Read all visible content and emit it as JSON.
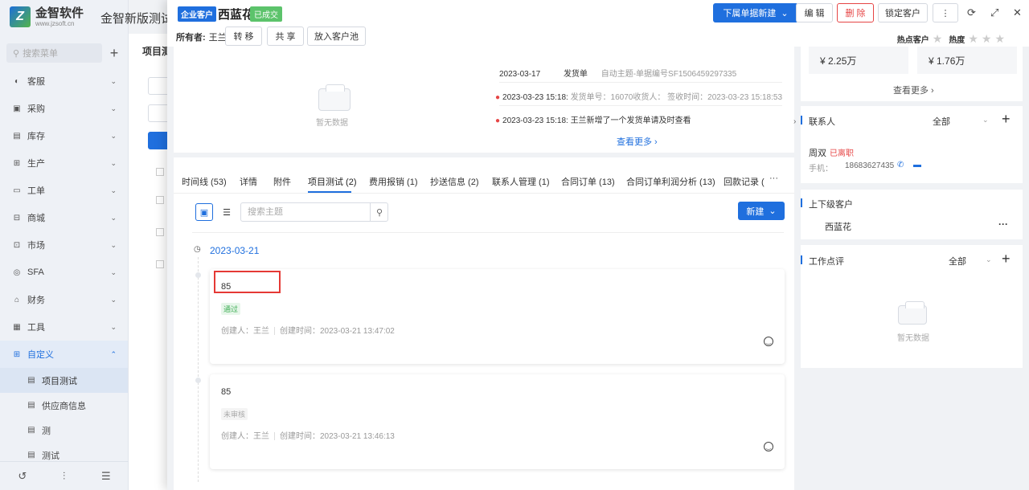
{
  "sidebar": {
    "logo_name": "金智软件",
    "logo_url": "www.jzsoft.cn",
    "search_placeholder": "搜索菜单",
    "items": [
      {
        "label": "客服",
        "icon": "service-icon"
      },
      {
        "label": "采购",
        "icon": "cart-icon"
      },
      {
        "label": "库存",
        "icon": "warehouse-icon"
      },
      {
        "label": "生产",
        "icon": "production-icon"
      },
      {
        "label": "工单",
        "icon": "ticket-icon"
      },
      {
        "label": "商城",
        "icon": "shop-icon"
      },
      {
        "label": "市场",
        "icon": "market-icon"
      },
      {
        "label": "SFA",
        "icon": "sfa-icon"
      },
      {
        "label": "财务",
        "icon": "finance-icon"
      },
      {
        "label": "工具",
        "icon": "tool-icon"
      },
      {
        "label": "自定义",
        "icon": "custom-icon"
      }
    ],
    "submenu": [
      {
        "label": "项目测试"
      },
      {
        "label": "供应商信息"
      },
      {
        "label": "测"
      },
      {
        "label": "测试"
      }
    ]
  },
  "bg_header": {
    "title": "金智新版测试公",
    "tab": "项目测"
  },
  "drawer": {
    "customer_tag": "企业客户",
    "customer_name": "西蓝花",
    "deal_tag": "已成交",
    "owner_label": "所有者:",
    "owner_name": "王兰",
    "buttons": {
      "transfer": "转 移",
      "share": "共 享",
      "to_pool": "放入客户池",
      "new_downstream": "下属单据新建",
      "edit": "编 辑",
      "delete": "删 除",
      "lock": "锁定客户",
      "more": "⋮"
    },
    "hot_label": "热点客户",
    "heat_label": "热度"
  },
  "top_card": {
    "empty_text": "暂无数据",
    "feed": [
      {
        "date": "2023-03-17",
        "type": "发货单",
        "text": "自动主题-单据编号SF1506459297335"
      },
      {
        "date": "2023-03-23 15:18:",
        "type": "",
        "text": "发货单号：16070收货人： 签收时间：2023-03-23 15:18:53"
      },
      {
        "date": "2023-03-23 15:18:",
        "type": "",
        "text": "王兰新增了一个发货单请及时查看"
      }
    ],
    "see_more": "查看更多"
  },
  "tabs": [
    {
      "label": "时间线 (53)"
    },
    {
      "label": "详情"
    },
    {
      "label": "附件"
    },
    {
      "label": "项目测试 (2)"
    },
    {
      "label": "费用报销 (1)"
    },
    {
      "label": "抄送信息 (2)"
    },
    {
      "label": "联系人管理 (1)"
    },
    {
      "label": "合同订单 (13)"
    },
    {
      "label": "合同订单利润分析 (13)"
    },
    {
      "label": "回款记录 ("
    },
    {
      "label": "···"
    }
  ],
  "toolbar": {
    "search_placeholder": "搜索主题",
    "create_label": "新建"
  },
  "timeline": {
    "date": "2023-03-21",
    "records": [
      {
        "value": "85",
        "status": "通过",
        "status_color": "#3fae55",
        "status_bg": "#e7f6ea",
        "creator": "创建人：王兰",
        "created": "创建时间：2023-03-21 13:47:02"
      },
      {
        "value": "85",
        "status": "未审核",
        "status_color": "#aaaaaa",
        "status_bg": "#f4f4f4",
        "creator": "创建人：王兰",
        "created": "创建时间：2023-03-21 13:46:13"
      }
    ]
  },
  "right": {
    "amount1": "¥ 2.25万",
    "amount2": "¥ 1.76万",
    "see_more": "查看更多",
    "contacts_title": "联系人",
    "contacts_filter": "全部",
    "contact_name": "周双",
    "contact_status": "已离职",
    "phone_label": "手机：",
    "phone": "18683627435",
    "parent_title": "上下级客户",
    "parent_name": "西蓝花",
    "parent_more": "···",
    "review_title": "工作点评",
    "review_filter": "全部",
    "review_empty": "暂无数据"
  }
}
